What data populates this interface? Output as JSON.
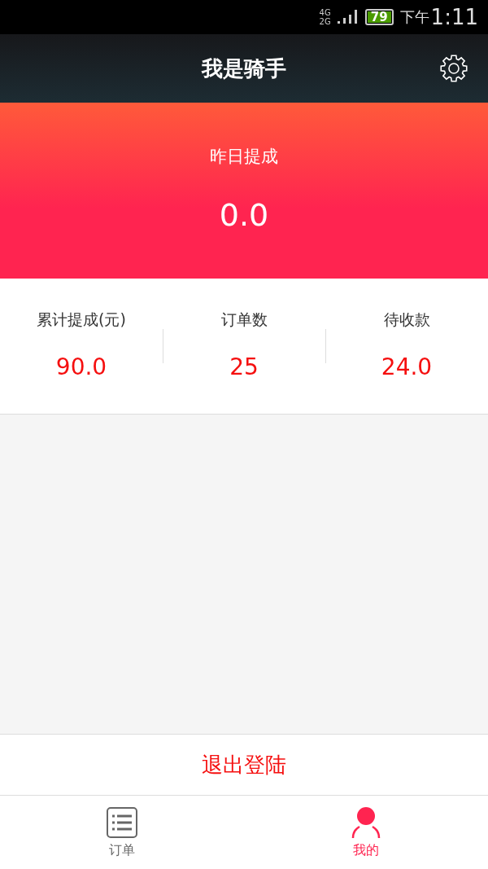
{
  "status_bar": {
    "network_top": "4G",
    "network_bottom": "2G",
    "battery": "79",
    "time_prefix": "下午",
    "time": "1:11"
  },
  "header": {
    "title": "我是骑手"
  },
  "banner": {
    "label": "昨日提成",
    "value": "0.0"
  },
  "stats": [
    {
      "label": "累计提成(元)",
      "value": "90.0"
    },
    {
      "label": "订单数",
      "value": "25"
    },
    {
      "label": "待收款",
      "value": "24.0"
    }
  ],
  "logout": {
    "label": "退出登陆"
  },
  "tabs": [
    {
      "label": "订单",
      "kind": "list",
      "selected": false
    },
    {
      "label": "我的",
      "kind": "person",
      "selected": true
    }
  ]
}
